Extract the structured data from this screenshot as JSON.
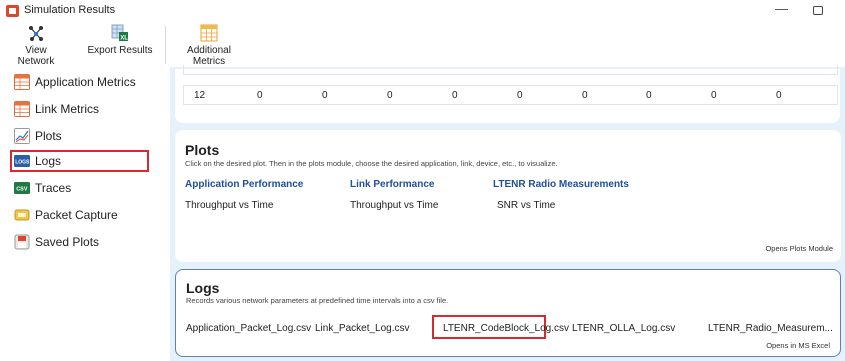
{
  "window": {
    "title": "Simulation Results"
  },
  "toolbar": {
    "view_network": "View Network",
    "export_results": "Export Results",
    "additional_metrics": "Additional Metrics"
  },
  "sidebar": {
    "items": [
      {
        "label": "Application Metrics",
        "icon": "table-icon"
      },
      {
        "label": "Link Metrics",
        "icon": "table-icon"
      },
      {
        "label": "Plots",
        "icon": "chart-icon"
      },
      {
        "label": "Logs",
        "icon": "logs-icon"
      },
      {
        "label": "Traces",
        "icon": "csv-icon"
      },
      {
        "label": "Packet Capture",
        "icon": "packet-capture-icon"
      },
      {
        "label": "Saved Plots",
        "icon": "saved-plots-icon"
      }
    ],
    "selected": "Logs"
  },
  "table": {
    "row": [
      "12",
      "0",
      "0",
      "0",
      "0",
      "0",
      "0",
      "0",
      "0",
      "0"
    ]
  },
  "plots": {
    "title": "Plots",
    "description": "Click on the desired plot. Then in the plots module, choose the desired application, link, device, etc., to visualize.",
    "columns": [
      {
        "header": "Application Performance",
        "items": [
          "Throughput vs Time"
        ]
      },
      {
        "header": "Link Performance",
        "items": [
          "Throughput vs Time"
        ]
      },
      {
        "header": "LTENR Radio Measurements",
        "items": [
          "SNR vs Time"
        ]
      }
    ],
    "footer": "Opens Plots Module"
  },
  "logs": {
    "title": "Logs",
    "description": "Records various network parameters at predefined time intervals into a csv file.",
    "files": [
      "Application_Packet_Log.csv",
      "Link_Packet_Log.csv",
      "LTENR_CodeBlock_Log.csv",
      "LTENR_OLLA_Log.csv",
      "LTENR_Radio_Measurem..."
    ],
    "footer": "Opens in MS Excel"
  },
  "colors": {
    "accent_blue": "#1f4e9c",
    "highlight_red": "#d9282f",
    "content_bg": "#e6f2fb"
  }
}
